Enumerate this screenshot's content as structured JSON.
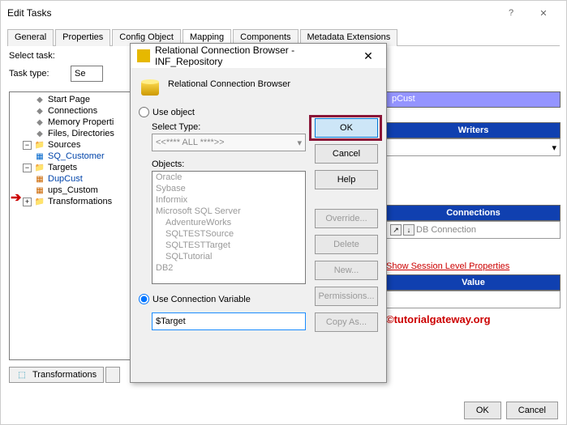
{
  "window": {
    "title": "Edit Tasks"
  },
  "tabs": {
    "general": "General",
    "properties": "Properties",
    "config": "Config Object",
    "mapping": "Mapping",
    "components": "Components",
    "metadata": "Metadata Extensions"
  },
  "form": {
    "select_task_label": "Select task:",
    "task_type_label": "Task type:",
    "task_type_value": "Se"
  },
  "tree": {
    "start_page": "Start Page",
    "connections": "Connections",
    "memory_props": "Memory Properti",
    "files_dirs": "Files, Directories",
    "sources": "Sources",
    "sq_customer": "SQ_Customer",
    "targets": "Targets",
    "dupcust": "DupCust",
    "ups_custom": "ups_Custom",
    "transformations": "Transformations"
  },
  "bottom_tabs": {
    "transformations": "Transformations"
  },
  "right": {
    "pcust": "pCust",
    "writers": "Writers",
    "connections": "Connections",
    "db_conn": "DB Connection",
    "show_session": "Show Session Level Properties",
    "value": "Value"
  },
  "watermark": "©tutorialgateway.org",
  "dialog": {
    "title": "Relational Connection Browser - INF_Repository",
    "header": "Relational Connection Browser",
    "use_object": "Use object",
    "select_type": "Select Type:",
    "select_type_value": "<<**** ALL ****>>",
    "objects_label": "Objects:",
    "objects": {
      "oracle": "Oracle",
      "sybase": "Sybase",
      "informix": "Informix",
      "mssql": "Microsoft SQL Server",
      "adv": "AdventureWorks",
      "sqlsrc": "SQLTESTSource",
      "sqltgt": "SQLTESTTarget",
      "sqltut": "SQLTutorial",
      "db2": "DB2"
    },
    "use_conn_var": "Use Connection Variable",
    "conn_var_value": "$Target",
    "buttons": {
      "ok": "OK",
      "cancel": "Cancel",
      "help": "Help",
      "override": "Override...",
      "delete": "Delete",
      "new": "New...",
      "permissions": "Permissions...",
      "copy_as": "Copy As..."
    }
  },
  "main_buttons": {
    "ok": "OK",
    "cancel": "Cancel"
  }
}
